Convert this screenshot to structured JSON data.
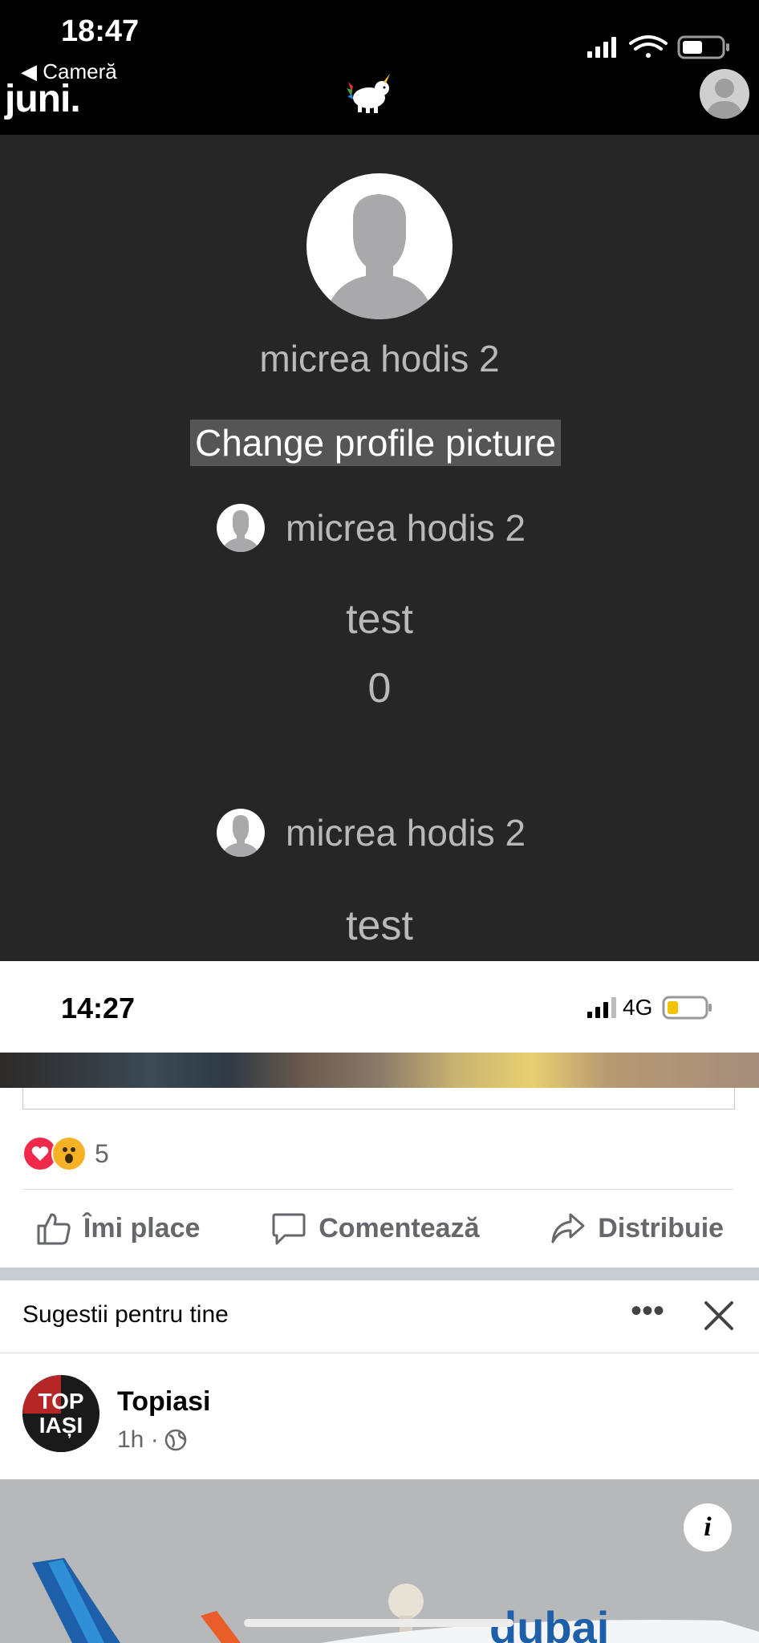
{
  "status_bar": {
    "time": "18:47",
    "back_label": "◀ Cameră"
  },
  "header": {
    "logo": "juni."
  },
  "profile": {
    "name": "micrea hodis 2",
    "change_picture_label": "Change profile picture"
  },
  "posts": [
    {
      "author": "micrea hodis 2",
      "text": "test",
      "count": "0"
    },
    {
      "author": "micrea hodis 2",
      "text": "test"
    }
  ],
  "facebook": {
    "status_time": "14:27",
    "network": "4G",
    "reactions_count": "5",
    "actions": {
      "like": "Îmi place",
      "comment": "Comentează",
      "share": "Distribuie"
    },
    "suggestions_label": "Sugestii pentru tine",
    "more_label": "•••",
    "page": {
      "name": "Topiasi",
      "time": "1h ·",
      "logo_text_top": "TOP",
      "logo_text_bottom": "IAȘI"
    },
    "info_label": "i",
    "ad_text": "dubai"
  },
  "colors": {
    "dark_bg": "#262626",
    "black_bar": "#000000",
    "fb_gray_text": "#65676b",
    "highlight": "#555555"
  }
}
